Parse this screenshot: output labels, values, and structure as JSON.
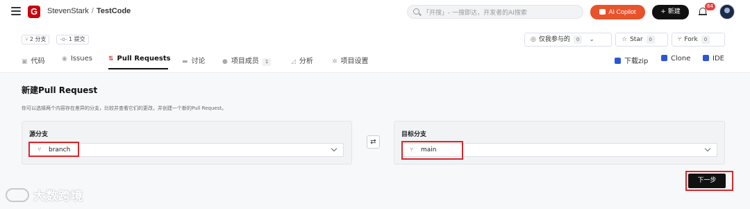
{
  "header": {
    "owner": "StevenStark",
    "separator": "/",
    "repo": "TestCode",
    "logo_letter": "G",
    "search_placeholder": "「开搜」- 一搜即达，开发者的AI搜索",
    "copilot_label": "AI Copilot",
    "new_label": "+ 新建",
    "notification_count": "64",
    "brand_color": "#c7000b",
    "copilot_color": "#e8532b"
  },
  "repo_meta": {
    "branches": "2 分支",
    "commits": "1 提交",
    "watch_label": "仅我参与的",
    "watch_count": "0",
    "star_label": "Star",
    "star_count": "0",
    "fork_label": "Fork",
    "fork_count": "0"
  },
  "tabs": [
    {
      "label": "代码",
      "icon": "code-icon"
    },
    {
      "label": "Issues",
      "icon": "issues-icon"
    },
    {
      "label": "Pull Requests",
      "icon": "pull-request-icon",
      "active": true
    },
    {
      "label": "讨论",
      "icon": "discussion-icon"
    },
    {
      "label": "项目成员",
      "icon": "members-icon",
      "count": "1"
    },
    {
      "label": "分析",
      "icon": "analytics-icon"
    },
    {
      "label": "项目设置",
      "icon": "settings-icon"
    }
  ],
  "repo_actions": {
    "download": "下载zip",
    "clone": "Clone",
    "ide": "IDE"
  },
  "main": {
    "title": "新建Pull Request",
    "description": "你可以选择两个内容存在差异的分支，比较并查看它们的更改，并创建一个新的Pull Request。",
    "source_label": "源分支",
    "source_value": "branch",
    "target_label": "目标分支",
    "target_value": "main",
    "next_label": "下一步",
    "highlight_color": "#d9262a"
  },
  "watermark": "大数跨境"
}
